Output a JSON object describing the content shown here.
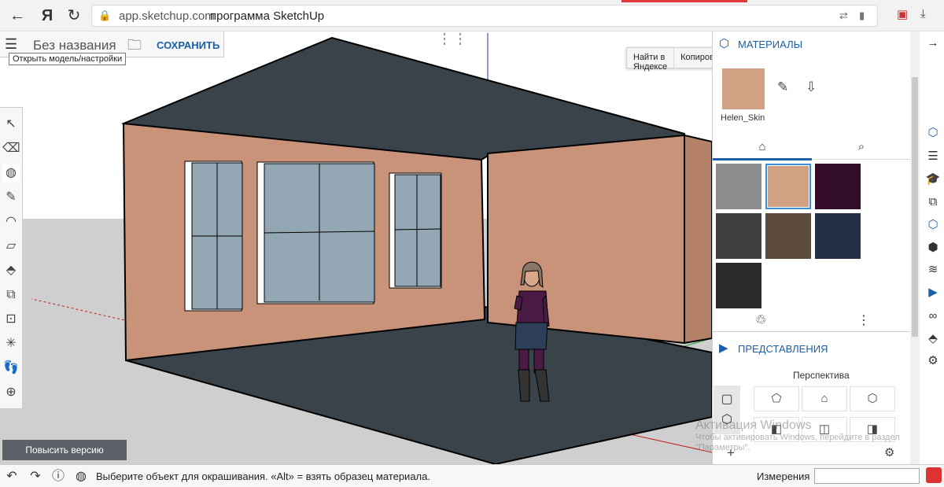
{
  "browser": {
    "url_host": "app.sketchup.com",
    "page_title": "программа SketchUp",
    "back_icon": "arrow-left",
    "yandex_label": "Я",
    "reload_icon": "reload"
  },
  "model": {
    "name": "Без названия",
    "save_label": "СОХРАНИТЬ",
    "menu_tooltip": "Открыть модель/настройки"
  },
  "context_menu": {
    "items": [
      "Найти в Яндексе",
      "Копировать"
    ]
  },
  "upgrade_label": "Повысить версию",
  "materials": {
    "title": "МАТЕРИАЛЫ",
    "current_name": "Helen_Skin",
    "current_color": "#d2a184",
    "swatches": [
      "#8c8c8c",
      "#d2a184",
      "#320c2a",
      "#3f3f40",
      "#5c4a3c",
      "#223044",
      "#2a2a2a"
    ],
    "selected_index": 1
  },
  "views": {
    "title": "ПРЕДСТАВЛЕНИЯ",
    "perspective_label": "Перспектива"
  },
  "watermark": {
    "line1": "Активация Windows",
    "line2": "Чтобы активировать Windows, перейдите в раздел \"Параметры\"."
  },
  "status": {
    "hint": "Выберите объект для окрашивания. «Alt» = взять образец материала.",
    "measurements_label": "Измерения",
    "measurements_value": ""
  },
  "colors": {
    "accent": "#1a5fa8",
    "wall": "#c9937a",
    "floor": "#3a434a",
    "glass": "#93a6b4"
  }
}
